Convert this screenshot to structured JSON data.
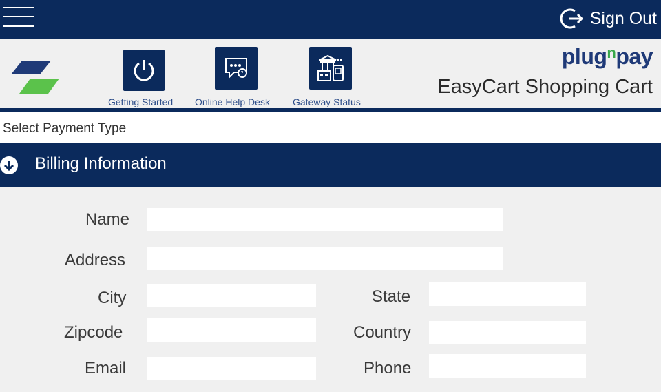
{
  "header": {
    "menu_icon": "hamburger-icon",
    "signout_label": "Sign Out",
    "signout_icon": "sign-out-icon"
  },
  "brand": {
    "logo_icon": "plugnpay-mark-icon",
    "name_part1": "plug",
    "name_part2": "n",
    "name_part3": "pay",
    "subtitle": "EasyCart Shopping Cart"
  },
  "quicklinks": [
    {
      "label": "Getting Started",
      "icon": "power-icon"
    },
    {
      "label": "Online Help Desk",
      "icon": "chat-help-icon"
    },
    {
      "label": "Gateway Status",
      "icon": "gateway-status-icon"
    }
  ],
  "sections": {
    "payment_type": "Select Payment Type",
    "billing": "Billing Information",
    "billing_icon": "arrow-down-circle-icon"
  },
  "billing_form": {
    "name": {
      "label": "Name",
      "value": ""
    },
    "address": {
      "label": "Address",
      "value": ""
    },
    "city": {
      "label": "City",
      "value": ""
    },
    "state": {
      "label": "State",
      "value": ""
    },
    "zipcode": {
      "label": "Zipcode",
      "value": ""
    },
    "country": {
      "label": "Country",
      "value": ""
    },
    "email": {
      "label": "Email",
      "value": ""
    },
    "phone": {
      "label": "Phone",
      "value": ""
    }
  },
  "colors": {
    "navy": "#0b2a5c",
    "background": "#f0f0f0",
    "brand_blue": "#1f3a78",
    "brand_green": "#38a84a",
    "logo_light_green": "#5bc24b"
  }
}
